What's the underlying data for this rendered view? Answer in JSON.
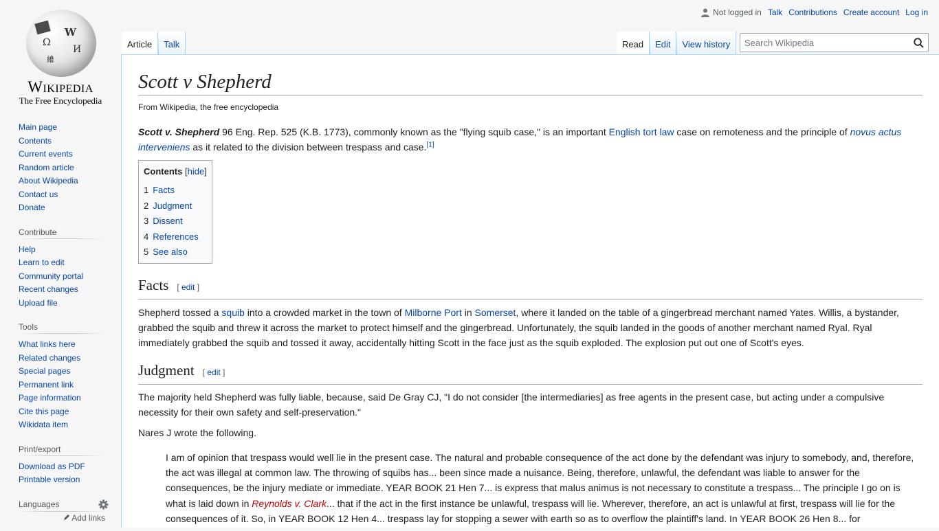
{
  "logo": {
    "wordmark": "Wikipedia",
    "tagline": "The Free Encyclopedia",
    "glyphs": [
      "Ω",
      "W",
      "И",
      "維"
    ]
  },
  "personal": {
    "status": "Not logged in",
    "links": [
      "Talk",
      "Contributions",
      "Create account",
      "Log in"
    ]
  },
  "tabs": {
    "left": [
      {
        "label": "Article",
        "selected": true
      },
      {
        "label": "Talk",
        "selected": false
      }
    ],
    "right": [
      {
        "label": "Read",
        "selected": true
      },
      {
        "label": "Edit",
        "selected": false
      },
      {
        "label": "View history",
        "selected": false
      }
    ]
  },
  "search": {
    "placeholder": "Search Wikipedia",
    "icon": "search-icon"
  },
  "sidebar": {
    "navigation": [
      "Main page",
      "Contents",
      "Current events",
      "Random article",
      "About Wikipedia",
      "Contact us",
      "Donate"
    ],
    "contribute": {
      "heading": "Contribute",
      "items": [
        "Help",
        "Learn to edit",
        "Community portal",
        "Recent changes",
        "Upload file"
      ]
    },
    "tools": {
      "heading": "Tools",
      "items": [
        "What links here",
        "Related changes",
        "Special pages",
        "Permanent link",
        "Page information",
        "Cite this page",
        "Wikidata item"
      ]
    },
    "print": {
      "heading": "Print/export",
      "items": [
        "Download as PDF",
        "Printable version"
      ]
    },
    "languages": {
      "heading": "Languages",
      "add_links": "Add links"
    }
  },
  "article": {
    "title": "Scott v Shepherd",
    "subtitle": "From Wikipedia, the free encyclopedia",
    "lead": {
      "bold": "Scott v. Shepherd",
      "t1": " 96 Eng. Rep. 525 (K.B. 1773), commonly known as the \"flying squib case,\" is an important ",
      "link1": "English tort law",
      "t2": " case on remoteness and the principle of ",
      "link2": "novus actus interveniens",
      "t3": " as it related to the division between trespass and case.",
      "ref": "[1]"
    },
    "toc": {
      "title": "Contents",
      "hide_open": "[",
      "hide": "hide",
      "hide_close": "]",
      "items": [
        {
          "num": "1",
          "label": "Facts"
        },
        {
          "num": "2",
          "label": "Judgment"
        },
        {
          "num": "3",
          "label": "Dissent"
        },
        {
          "num": "4",
          "label": "References"
        },
        {
          "num": "5",
          "label": "See also"
        }
      ]
    },
    "edit_open": "[ ",
    "edit_label": "edit",
    "edit_close": " ]",
    "facts": {
      "heading": "Facts",
      "t1": "Shepherd tossed a ",
      "link1": "squib",
      "t2": " into a crowded market in the town of ",
      "link2": "Milborne Port",
      "t3": " in ",
      "link3": "Somerset",
      "t4": ", where it landed on the table of a gingerbread merchant named Yates. Willis, a bystander, grabbed the squib and threw it across the market to protect himself and the gingerbread. Unfortunately, the squib landed in the goods of another merchant named Ryal. Ryal immediately grabbed the squib and tossed it away, accidentally hitting Scott in the face just as the squib exploded. The explosion put out one of Scott's eyes."
    },
    "judgment": {
      "heading": "Judgment",
      "p1": "The majority held Shepherd was fully liable, because, said De Gray CJ, \"I do not consider [the intermediaries] as free agents in the present case, but acting under a compulsive necessity for their own safety and self-preservation.\"",
      "p2": "Nares J wrote the following.",
      "quote_t1": "I am of opinion that trespass would well lie in the present case. The natural and probable consequence of the act done by the defendant was injury to somebody, and, therefore, the act was illegal at common law. The throwing of squibs has... been since made a nuisance. Being, therefore, unlawful, the defendant was liable to answer for the consequences, be the injury mediate or immediate. YEAR BOOK 21 Hen 7... is express that malus animus is not necessary to constitute a trespass... The principle I go on is what is laid down in ",
      "quote_link": "Reynolds v. Clark",
      "quote_t2": "... that if the act in the first instance be unlawful, trespass will lie. Wherever, therefore, an act is unlawful at first, trespass will lie for the consequences of it. So, in YEAR BOOK 12 Hen 4... trespass lay for stopping a sewer with earth so as to overflow the plaintiff's land. In YEAR BOOK 26 Hen 8... for"
    }
  }
}
